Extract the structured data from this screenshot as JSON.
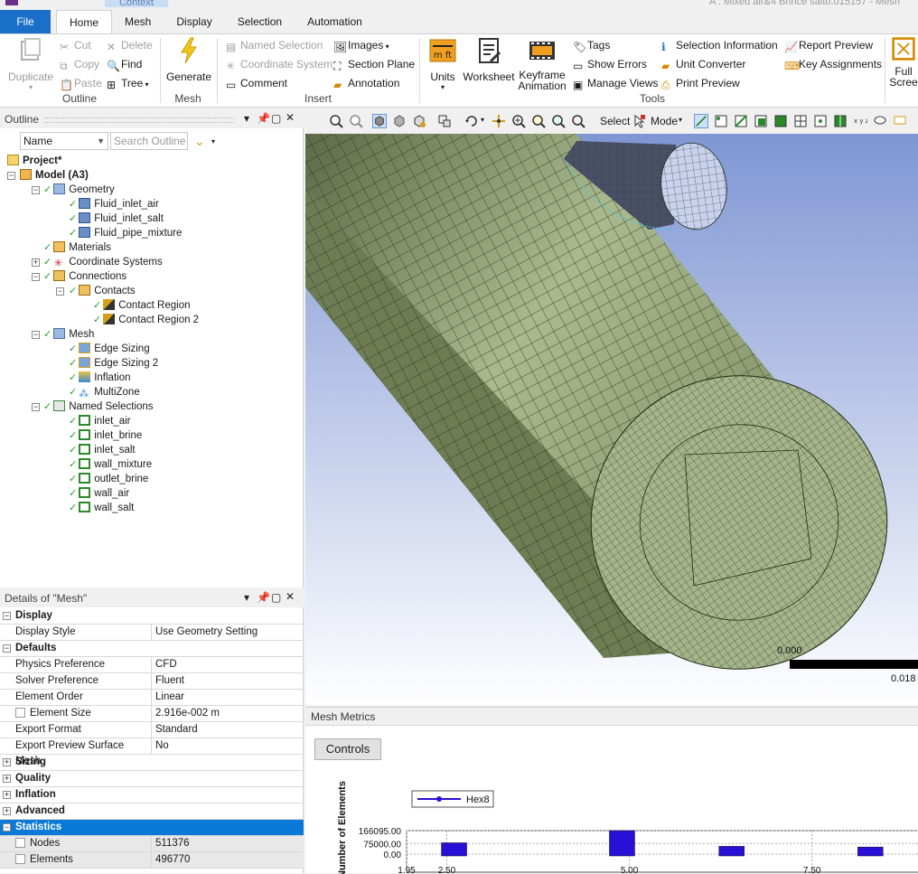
{
  "window": {
    "context_tab": "Context",
    "title": "A : Mixed air&4 Brince salto.015157 - Mesh"
  },
  "tabs": {
    "file": "File",
    "items": [
      "Home",
      "Mesh",
      "Display",
      "Selection",
      "Automation"
    ],
    "active": "Home"
  },
  "ribbon": {
    "outline": {
      "label": "Outline",
      "duplicate": "Duplicate",
      "cut": "Cut",
      "copy": "Copy",
      "paste": "Paste",
      "delete": "Delete",
      "find": "Find",
      "tree": "Tree"
    },
    "mesh": {
      "label": "Mesh",
      "generate": "Generate"
    },
    "insert": {
      "label": "Insert",
      "named_selection": "Named Selection",
      "coordinate_system": "Coordinate System",
      "comment": "Comment",
      "images": "Images",
      "section_plane": "Section Plane",
      "annotation": "Annotation"
    },
    "tools": {
      "label": "Tools",
      "units": "Units",
      "worksheet": "Worksheet",
      "keyframe": "Keyframe",
      "animation": "Animation",
      "tags": "Tags",
      "show_errors": "Show Errors",
      "manage_views": "Manage Views",
      "selection_information": "Selection Information",
      "unit_converter": "Unit Converter",
      "print_preview": "Print Preview",
      "report_preview": "Report Preview",
      "key_assignments": "Key Assignments"
    },
    "full_screen": {
      "line1": "Full",
      "line2": "Scree"
    }
  },
  "outline": {
    "title": "Outline",
    "name_filter": "Name",
    "search_placeholder": "Search Outline",
    "tree": {
      "project": "Project*",
      "model": "Model (A3)",
      "geometry": "Geometry",
      "geometry_items": [
        "Fluid_inlet_air",
        "Fluid_inlet_salt",
        "Fluid_pipe_mixture"
      ],
      "materials": "Materials",
      "coordinate_systems": "Coordinate Systems",
      "connections": "Connections",
      "contacts": "Contacts",
      "contact_items": [
        "Contact Region",
        "Contact Region 2"
      ],
      "mesh": "Mesh",
      "mesh_items": [
        "Edge Sizing",
        "Edge Sizing 2",
        "Inflation",
        "MultiZone"
      ],
      "named_selections": "Named Selections",
      "named_items": [
        "inlet_air",
        "inlet_brine",
        "inlet_salt",
        "wall_mixture",
        "outlet_brine",
        "wall_air",
        "wall_salt"
      ]
    }
  },
  "details": {
    "title": "Details of \"Mesh\"",
    "display": {
      "section": "Display",
      "display_style_label": "Display Style",
      "display_style_value": "Use Geometry Setting"
    },
    "defaults": {
      "section": "Defaults",
      "physics_preference_label": "Physics Preference",
      "physics_preference_value": "CFD",
      "solver_preference_label": "Solver Preference",
      "solver_preference_value": "Fluent",
      "element_order_label": "Element Order",
      "element_order_value": "Linear",
      "element_size_label": "Element Size",
      "element_size_value": "2.916e-002 m",
      "export_format_label": "Export Format",
      "export_format_value": "Standard",
      "export_preview_label": "Export Preview Surface Mesh",
      "export_preview_value": "No"
    },
    "sizing": "Sizing",
    "quality": "Quality",
    "inflation": "Inflation",
    "advanced": "Advanced",
    "statistics": {
      "section": "Statistics",
      "nodes_label": "Nodes",
      "nodes_value": "511376",
      "elements_label": "Elements",
      "elements_value": "496770"
    }
  },
  "viewport_toolbar": {
    "select": "Select",
    "mode": "Mode"
  },
  "scale_bar": {
    "start": "0.000",
    "end": "0.018"
  },
  "mesh_metrics": {
    "title": "Mesh Metrics",
    "controls": "Controls",
    "chart_data": {
      "type": "bar",
      "ylabel": "Number of Elements",
      "legend": [
        "Hex8"
      ],
      "y_ticks": [
        "166095.00",
        "75000.00",
        "0.00"
      ],
      "x_ticks": [
        "1.95",
        "2.50",
        "5.00",
        "7.50"
      ],
      "series": [
        {
          "name": "Hex8",
          "x": [
            2.6,
            4.9,
            6.4,
            8.3
          ],
          "values": [
            80000,
            166095,
            55000,
            50000
          ]
        }
      ],
      "colors": {
        "bar": "#2a0fd6"
      }
    }
  }
}
